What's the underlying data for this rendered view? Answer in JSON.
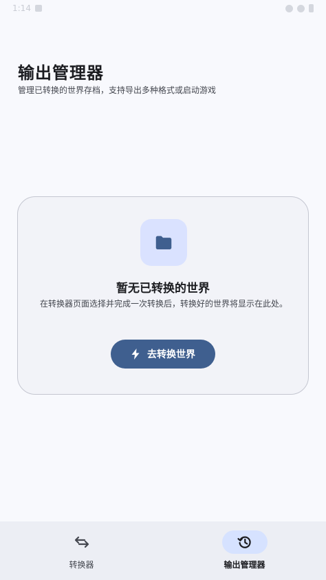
{
  "status_bar": {
    "time": "1:14"
  },
  "header": {
    "title": "输出管理器",
    "subtitle": "管理已转换的世界存档，支持导出多种格式或启动游戏"
  },
  "empty_state": {
    "icon": "folder-icon",
    "title": "暂无已转换的世界",
    "description": "在转换器页面选择并完成一次转换后，转换好的世界将显示在此处。",
    "button_label": "去转换世界",
    "button_icon": "bolt-icon"
  },
  "bottom_nav": {
    "items": [
      {
        "label": "转换器",
        "icon": "swap-arrows-icon",
        "active": false
      },
      {
        "label": "输出管理器",
        "icon": "history-icon",
        "active": true
      }
    ]
  },
  "colors": {
    "background": "#f8f9fd",
    "card": "#f2f3f8",
    "primary": "#3f5f8f",
    "icon_tile": "#dae2ff",
    "nav_background": "#eceef4",
    "nav_active_pill": "#d6e2ff"
  }
}
